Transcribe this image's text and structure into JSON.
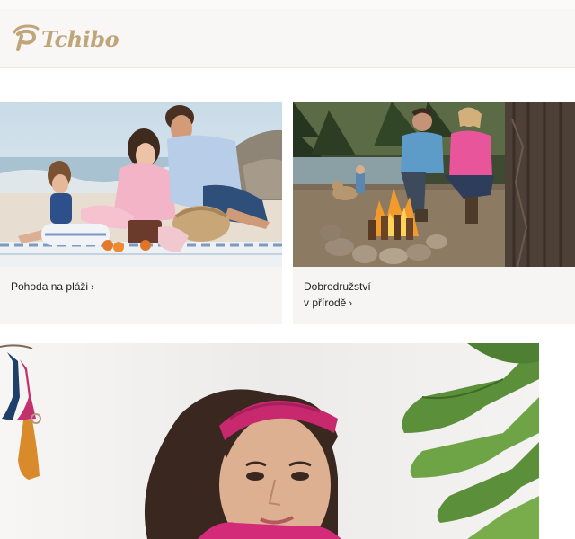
{
  "header": {
    "brand": "Tchibo",
    "colors": {
      "brand": "#c1a57a",
      "header_bg": "#f8f7f5"
    }
  },
  "cards": [
    {
      "label": "Pohoda na pláži",
      "chevron": "›",
      "image": "family-on-beach-picnic"
    },
    {
      "label_line1": "Dobrodružství",
      "label_line2": "v přírodě",
      "chevron": "›",
      "image": "family-at-campfire-in-forest"
    }
  ],
  "hero": {
    "image": "woman-with-pink-headband-and-plant"
  },
  "icons": [
    "tchibo-logo-icon",
    "chevron-right-icon"
  ]
}
